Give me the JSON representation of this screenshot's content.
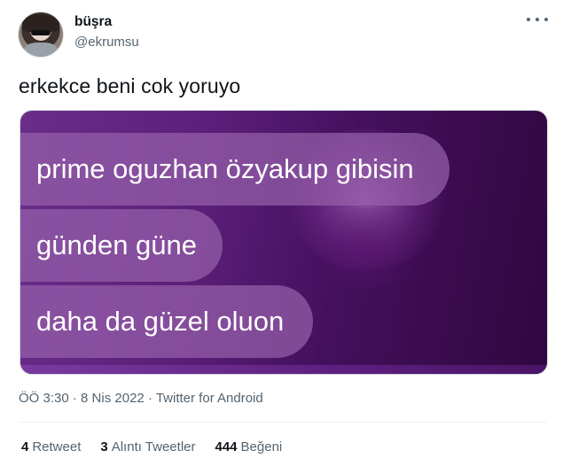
{
  "user": {
    "name": "büşra",
    "handle": "@ekrumsu"
  },
  "tweet": {
    "text": "erkekce beni cok yoruyo"
  },
  "media": {
    "lines": [
      "prime oguzhan özyakup gibisin",
      "günden güne",
      "daha da güzel oluon"
    ]
  },
  "meta": {
    "time": "ÖÖ 3:30",
    "sep1": "·",
    "date": "8 Nis 2022",
    "sep2": "·",
    "source": "Twitter for Android"
  },
  "stats": {
    "retweets_count": "4",
    "retweets_label": "Retweet",
    "quotes_count": "3",
    "quotes_label": "Alıntı Tweetler",
    "likes_count": "444",
    "likes_label": "Beğeni"
  },
  "colors": {
    "text_primary": "#0f1419",
    "text_secondary": "#536471",
    "media_purple": "#5a1f78"
  },
  "icons": {
    "more": "more-horizontal-icon"
  }
}
